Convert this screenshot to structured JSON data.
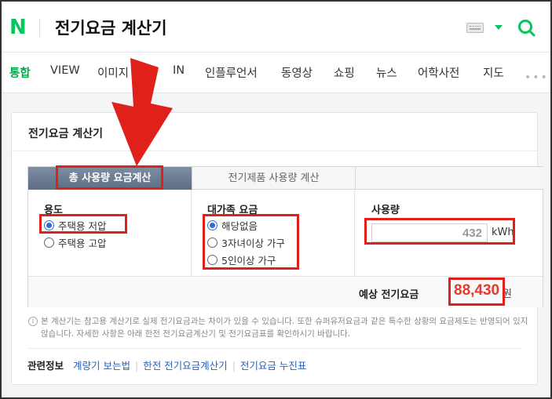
{
  "header": {
    "logo": "N",
    "query": "전기요금 계산기",
    "icons": [
      "keyboard-icon",
      "caret-down-icon",
      "search-icon"
    ],
    "brand_color": "#03c75a"
  },
  "tabs": [
    {
      "label": "통합",
      "active": true
    },
    {
      "label": "VIEW"
    },
    {
      "label": "이미지"
    },
    {
      "label": "IN"
    },
    {
      "label": "인플루언서"
    },
    {
      "label": "동영상"
    },
    {
      "label": "쇼핑"
    },
    {
      "label": "뉴스"
    },
    {
      "label": "어학사전"
    },
    {
      "label": "지도"
    }
  ],
  "card": {
    "title": "전기요금 계산기",
    "calc_tabs": [
      "총 사용량 요금계산",
      "전기제품 사용량 계산"
    ],
    "usage_type": {
      "title": "용도",
      "options": [
        {
          "label": "주택용 저압",
          "checked": true
        },
        {
          "label": "주택용 고압",
          "checked": false
        }
      ]
    },
    "large_family": {
      "title": "대가족 요금",
      "options": [
        {
          "label": "해당없음",
          "checked": true
        },
        {
          "label": "3자녀이상 가구",
          "checked": false
        },
        {
          "label": "5인이상 가구",
          "checked": false
        }
      ]
    },
    "usage": {
      "title": "사용량",
      "value": "432",
      "unit": "kWh"
    },
    "result": {
      "label": "예상 전기요금",
      "value": "88,430",
      "unit": "원",
      "color": "#e8382c"
    },
    "notice": "본 계산기는 참고용 계산기로 실제 전기요금과는 차이가 있을 수 있습니다. 또한 슈퍼유저요금과 같은 특수한 상황의 요금제도는 반영되어 있지 않습니다. 자세한 사항은 아래 한전 전기요금계산기 및 전기요금표를 확인하시기 바랍니다.",
    "related": {
      "label": "관련정보",
      "links": [
        "계량기 보는법",
        "한전 전기요금계산기",
        "전기요금 누진표"
      ]
    }
  },
  "annotation_color": "#e0201a"
}
